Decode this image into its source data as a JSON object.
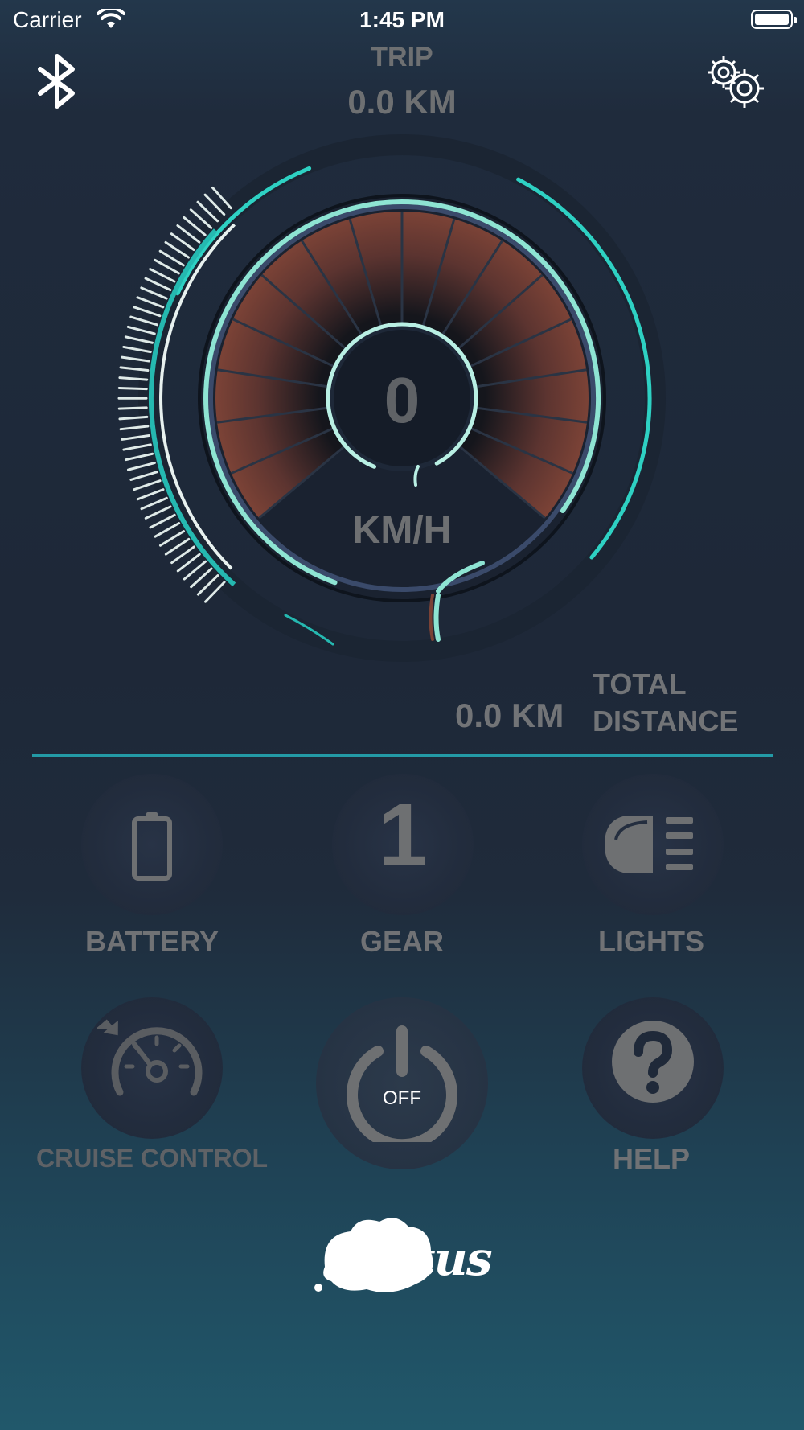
{
  "status_bar": {
    "carrier": "Carrier",
    "time": "1:45 PM"
  },
  "trip": {
    "label": "TRIP",
    "value": "0.0 KM"
  },
  "speedometer": {
    "speed": "0",
    "unit": "KM/H"
  },
  "total_distance": {
    "value": "0.0 KM",
    "label_line1": "TOTAL",
    "label_line2": "DISTANCE"
  },
  "controls": {
    "battery": {
      "label": "BATTERY",
      "icon": "battery-icon"
    },
    "gear": {
      "label": "GEAR",
      "value": "1"
    },
    "lights": {
      "label": "LIGHTS",
      "icon": "headlight-icon"
    },
    "cruise_control": {
      "label": "CRUISE CONTROL",
      "icon": "speedometer-icon"
    },
    "power": {
      "label": "OFF",
      "icon": "power-icon"
    },
    "help": {
      "label": "HELP",
      "icon": "question-icon"
    }
  },
  "logo": {
    "text": "Motus"
  },
  "colors": {
    "accent": "#3cc8c0",
    "divider": "#239aa6",
    "gauge_fill": "#7a4236",
    "text_muted": "#707275"
  }
}
